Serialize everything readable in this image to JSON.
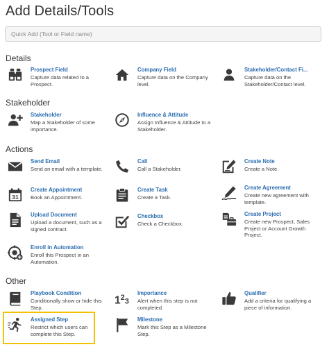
{
  "header": {
    "title": "Add Details/Tools"
  },
  "search": {
    "placeholder": "Quick Add (Tool or Field name)"
  },
  "sections": {
    "details": "Details",
    "stakeholder": "Stakeholder",
    "actions": "Actions",
    "other": "Other"
  },
  "tools": {
    "prospect_field": {
      "name": "Prospect Field",
      "desc": "Capture data related to a Prospect.",
      "icon": "binoculars-icon"
    },
    "company_field": {
      "name": "Company Field",
      "desc": "Capture data on the Company level.",
      "icon": "home-icon"
    },
    "stakeholder_contact_field": {
      "name": "Stakeholder/Contact Fi...",
      "desc": "Capture data on the Stakeholder/Contact level.",
      "icon": "person-icon"
    },
    "stakeholder": {
      "name": "Stakeholder",
      "desc": "Map a Stakeholder of some importance.",
      "icon": "add-person-icon"
    },
    "influence_attitude": {
      "name": "Influence & Attitude",
      "desc": "Assign Influence & Attitude to a Stakeholder.",
      "icon": "compass-icon"
    },
    "send_email": {
      "name": "Send Email",
      "desc": "Send an email with a template.",
      "icon": "envelope-icon"
    },
    "call": {
      "name": "Call",
      "desc": "Call a Stakeholder.",
      "icon": "phone-icon"
    },
    "create_note": {
      "name": "Create Note",
      "desc": "Create a Note.",
      "icon": "note-icon"
    },
    "create_appointment": {
      "name": "Create Appointment",
      "desc": "Book an Appointment.",
      "icon": "calendar-icon",
      "calendar_day": "31"
    },
    "create_task": {
      "name": "Create Task",
      "desc": "Create a Task.",
      "icon": "clipboard-icon"
    },
    "create_agreement": {
      "name": "Create Agreement",
      "desc": "Create new agreement with template.",
      "icon": "signature-icon"
    },
    "upload_document": {
      "name": "Upload Document",
      "desc": "Upload a document, such as a signed contract.",
      "icon": "document-icon"
    },
    "checkbox": {
      "name": "Checkbox",
      "desc": "Check a Checkbox.",
      "icon": "checkbox-icon"
    },
    "create_project": {
      "name": "Create Project",
      "desc": "Create new Prospect, Sales Project or Account Growth Project.",
      "icon": "project-icon"
    },
    "enroll_automation": {
      "name": "Enroll in Automation",
      "desc": "Enroll this Prospect in an Automation.",
      "icon": "automation-icon"
    },
    "playbook_condition": {
      "name": "Playbook Condition",
      "desc": "Conditionally show or hide this Step.",
      "icon": "book-icon"
    },
    "importance": {
      "name": "Importance",
      "desc": "Alert when this step is not completed.",
      "icon": "numbers-icon",
      "glyph": "123"
    },
    "qualifier": {
      "name": "Qualifier",
      "desc": "Add a criteria for qualifying a piece of information.",
      "icon": "thumbs-up-icon"
    },
    "assigned_step": {
      "name": "Assigned Step",
      "desc": "Restrict which users can complete this Step.",
      "icon": "runner-icon"
    },
    "milestone": {
      "name": "Milestone",
      "desc": "Mark this Step as a Milestone Step.",
      "icon": "flag-icon"
    }
  },
  "colors": {
    "link": "#2a6db0",
    "icon": "#3a3a3a",
    "highlight": "#f2c200"
  }
}
